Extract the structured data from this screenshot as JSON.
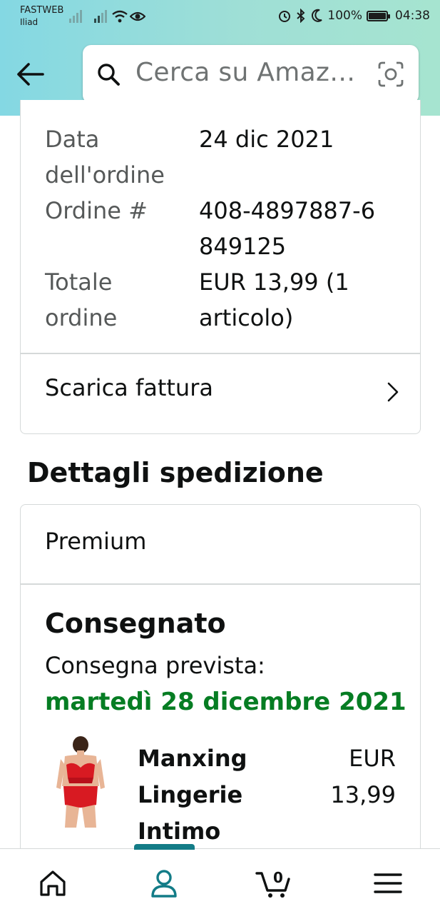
{
  "status_bar": {
    "carrier_1": "FASTWEB",
    "carrier_2": "Iliad",
    "battery": "100%",
    "time": "04:38"
  },
  "header": {
    "search_placeholder": "Cerca su Amaz…"
  },
  "order": {
    "rows": [
      {
        "label": "Data dell'ordine",
        "value": "24 dic 2021"
      },
      {
        "label": "Ordine #",
        "value": "408-4897887-6849125"
      },
      {
        "label": "Totale ordine",
        "value": "EUR 13,99 (1 articolo)"
      }
    ],
    "invoice_link": "Scarica fattura"
  },
  "shipping": {
    "section_title": "Dettagli spedizione",
    "method": "Premium",
    "status": "Consegnato",
    "expected_label": "Consegna prevista:",
    "expected_date": "martedì 28 dicembre 2021",
    "item": {
      "name": "Manxing Lingerie Intimo",
      "price": "EUR 13,99"
    }
  },
  "bottom_nav": {
    "cart_count": "0",
    "items": [
      "home-icon",
      "account-icon",
      "cart-icon",
      "menu-icon"
    ],
    "active": "account-icon"
  },
  "colors": {
    "accent": "#137c87",
    "delivery_green": "#067d23"
  }
}
